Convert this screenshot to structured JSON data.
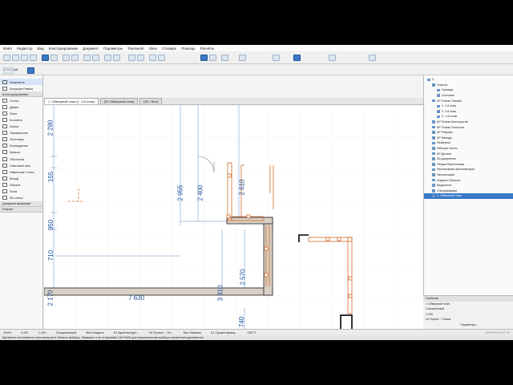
{
  "menu": [
    "Файл",
    "Редактор",
    "Вид",
    "Конструирование",
    "Документ",
    "Параметры",
    "Teamwork",
    "Окно",
    "Словарь",
    "Помощь",
    "Расчёты"
  ],
  "info_box": {
    "label": "Основной"
  },
  "toolbox": {
    "header": "Указатель",
    "items": [
      "Указатель",
      "Бегущая Рамка"
    ],
    "section_design": "Конструирование",
    "tools": [
      "Стена",
      "Дверь",
      "Окно",
      "Колонна",
      "Балка",
      "Перекрытие",
      "Лестница",
      "Ограждение",
      "Крыша",
      "Оболочка",
      "Световой люк",
      "Навесная Стена",
      "Морф",
      "Объект",
      "Зона",
      "3D-сетка"
    ],
    "section_doc": "Документирование",
    "section_more": "Разное"
  },
  "tabs": [
    "1. Обмерный план [1. 1-й этаж]",
    "[02 Обмерный план]",
    "[3D / Все]"
  ],
  "plan": {
    "dimensions": {
      "d2280": "2 280",
      "d155": "155",
      "d950": "950",
      "d710": "710",
      "d2170": "2 170",
      "d7630": "7 630",
      "d2955": "2 955",
      "d2400": "2 400",
      "d2610": "2 610",
      "d3310": "3 310",
      "d2570": "2 570",
      "d740": "740"
    }
  },
  "navigator": {
    "items": [
      {
        "label": "3",
        "indent": 0
      },
      {
        "label": "Участок",
        "indent": 1
      },
      {
        "label": "Границы",
        "indent": 2
      },
      {
        "label": "Состояне",
        "indent": 2
      },
      {
        "label": "АР Планы Этажей",
        "indent": 1
      },
      {
        "label": "1. 1-й этаж",
        "indent": 2
      },
      {
        "label": "2. 2-й этаж",
        "indent": 2
      },
      {
        "label": "3. -1-й этаж",
        "indent": 2
      },
      {
        "label": "АР Планы Конструктив",
        "indent": 1
      },
      {
        "label": "АР Планы Потолков",
        "indent": 1
      },
      {
        "label": "АР Разрезы",
        "indent": 1
      },
      {
        "label": "АР Фасады",
        "indent": 1
      },
      {
        "label": "Развертки",
        "indent": 1
      },
      {
        "label": "Рабочие Листы",
        "indent": 1
      },
      {
        "label": "АР Детали",
        "indent": 1
      },
      {
        "label": "3D-документы",
        "indent": 1
      },
      {
        "label": "Общая Перспектива",
        "indent": 1
      },
      {
        "label": "Фронтальная Аксонометрия",
        "indent": 1
      },
      {
        "label": "Экспликации",
        "indent": 1
      },
      {
        "label": "Индексы Проекта",
        "indent": 1
      },
      {
        "label": "Ведомости",
        "indent": 1
      },
      {
        "label": "Спецификации",
        "indent": 1
      },
      {
        "label": "1. Обмерный план",
        "indent": 1,
        "selected": true
      }
    ]
  },
  "properties": {
    "title": "Свойства",
    "rows": [
      "1  Обмерный план",
      "Специальный",
      "1:100",
      "04 Проект - Планы"
    ],
    "button": "Параметры..."
  },
  "status": {
    "zoom": "104%",
    "angle": "0,00°",
    "scale": "1:100",
    "layer": "Специальный",
    "model": "Вся Модель",
    "arch": "01 Архитектурн...",
    "project": "04 Проект - Пл...",
    "renovation": "Без Замены",
    "existing": "01 Существующ...",
    "unit": "ОЕСТ"
  },
  "hint": "Щелкните на элементе или начертите область выбора. Нажмите и не отпускайте Ctrl+Shift для переключения выбора элемента/подэлемента.",
  "brand": "GRAPHISOFT ID"
}
